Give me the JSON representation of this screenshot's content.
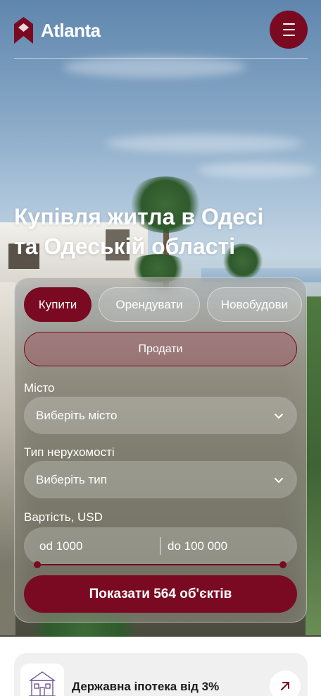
{
  "header": {
    "brand": "Atlanta",
    "menu_icon": "hamburger-menu-icon"
  },
  "hero": {
    "title_line1": "Купівля житла в Одесі",
    "title_line2": "та Одеській області"
  },
  "search": {
    "tabs": [
      {
        "label": "Купити",
        "active": true
      },
      {
        "label": "Орендувати",
        "active": false
      },
      {
        "label": "Новобудови",
        "active": false
      }
    ],
    "sell_label": "Продати",
    "city": {
      "label": "Місто",
      "placeholder": "Виберіть місто"
    },
    "type": {
      "label": "Тип нерухомості",
      "placeholder": "Виберіть тип"
    },
    "price": {
      "label": "Вартість, USD",
      "from": "od 1000",
      "to": "do 100 000"
    },
    "submit_label": "Показати 564 об'єктів"
  },
  "promo": {
    "title": "Державна іпотека від 3%"
  },
  "colors": {
    "brand": "#7a0a21",
    "text_light": "#ffffff"
  }
}
